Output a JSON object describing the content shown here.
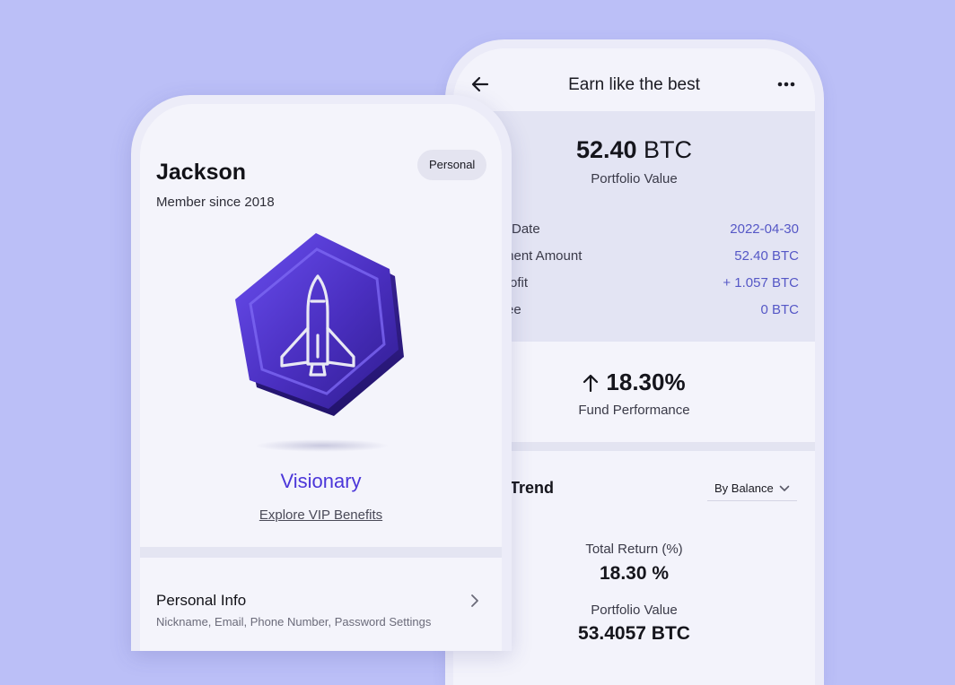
{
  "earn_screen": {
    "title": "Earn like the best",
    "portfolio": {
      "amount": "52.40",
      "currency": "BTC",
      "label": "Portfolio Value"
    },
    "details": [
      {
        "key": "Date",
        "value": "2022-04-30"
      },
      {
        "key": "ment Amount",
        "value": "52.40 BTC"
      },
      {
        "key": "rofit",
        "value": "+ 1.057 BTC"
      },
      {
        "key": "ee",
        "value": "0 BTC"
      }
    ],
    "fund_performance": {
      "value": "18.30%",
      "label": "Fund Performance"
    },
    "trend": {
      "title": "rmance Trend",
      "dropdown": "By Balance",
      "total_return_label": "Total Return (%)",
      "total_return_value": "18.30 %",
      "portfolio_value_label": "Portfolio Value",
      "portfolio_value": "53.4057 BTC"
    }
  },
  "profile_screen": {
    "name": "Jackson",
    "member_since": "Member since 2018",
    "account_type": "Personal",
    "tier": "Visionary",
    "vip_link": "Explore VIP Benefits",
    "menu": {
      "title": "Personal Info",
      "subtitle": "Nickname,  Email,  Phone Number,  Password Settings"
    }
  },
  "colors": {
    "background": "#bbbff7",
    "accent": "#4b36d9",
    "value_text": "#5557c6",
    "badge_fill": "#4a2fc0"
  }
}
